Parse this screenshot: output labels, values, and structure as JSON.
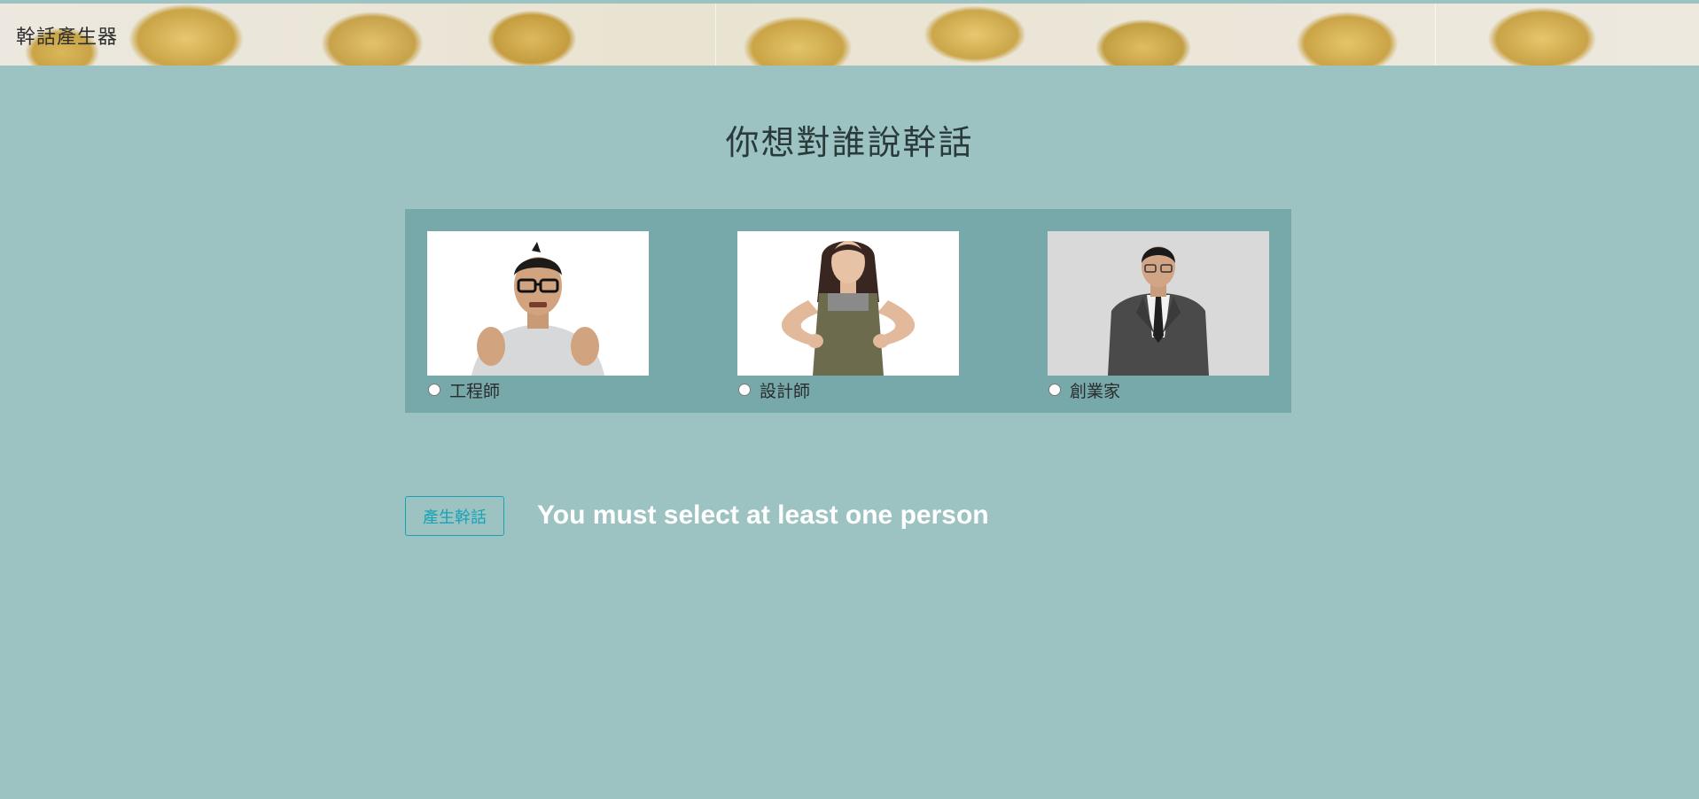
{
  "header": {
    "brand": "幹話產生器"
  },
  "main": {
    "title": "你想對誰說幹話"
  },
  "people": [
    {
      "label": "工程師",
      "icon": "person-icon"
    },
    {
      "label": "設計師",
      "icon": "person-icon"
    },
    {
      "label": "創業家",
      "icon": "person-icon"
    }
  ],
  "actions": {
    "generate_label": "產生幹話",
    "error_message": "You must select at least one person"
  },
  "colors": {
    "page_background": "#9cc3c1",
    "panel_background": "#77a9aa",
    "button_accent": "#17a2b8",
    "message_text": "#ffffff"
  }
}
